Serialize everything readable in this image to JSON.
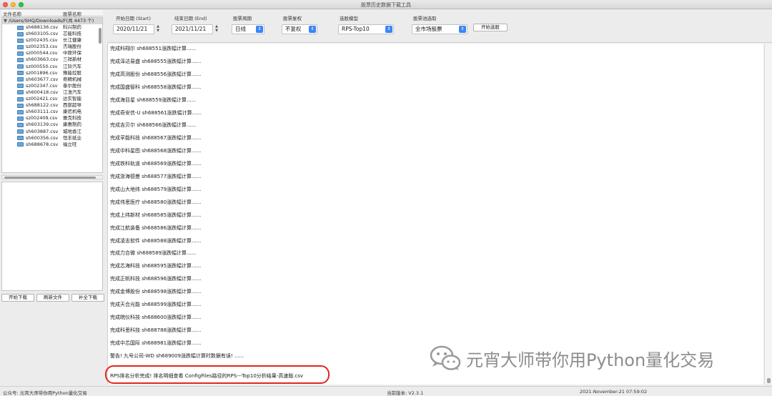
{
  "window": {
    "title": "股票历史数据下载工具"
  },
  "tree": {
    "col_file": "文件名称",
    "col_stock": "股票名称",
    "root": "/Users/SHQ/Downloads/F",
    "root_count": "(共 4473 个)",
    "rows": [
      {
        "file": "sh688136.csv",
        "name": "科兴制药"
      },
      {
        "file": "sh603105.csv",
        "name": "芯能科技"
      },
      {
        "file": "sz002435.csv",
        "name": "长江健康"
      },
      {
        "file": "sz002353.csv",
        "name": "杰瑞股份"
      },
      {
        "file": "sz000544.csv",
        "name": "中原环保"
      },
      {
        "file": "sh603663.csv",
        "name": "三祥新材"
      },
      {
        "file": "sz000550.csv",
        "name": "江铃汽车"
      },
      {
        "file": "sz001896.csv",
        "name": "豫能控股"
      },
      {
        "file": "sh603677.csv",
        "name": "奇精机械"
      },
      {
        "file": "sz002347.csv",
        "name": "泰尔股份"
      },
      {
        "file": "sh600418.csv",
        "name": "江淮汽车"
      },
      {
        "file": "sz002421.csv",
        "name": "达实智能"
      },
      {
        "file": "sh688122.csv",
        "name": "西部超导"
      },
      {
        "file": "sh603111.csv",
        "name": "康尼机电"
      },
      {
        "file": "sz002409.csv",
        "name": "雅克科技"
      },
      {
        "file": "sh603139.csv",
        "name": "康惠制药"
      },
      {
        "file": "sh603887.csv",
        "name": "城地香江"
      },
      {
        "file": "sh600356.csv",
        "name": "恒丰纸业"
      },
      {
        "file": "sh688678.csv",
        "name": "福立旺"
      }
    ]
  },
  "panel_buttons": {
    "download": "开始下载",
    "refresh": "刷新文件",
    "complete": "补全下载"
  },
  "toolbar": {
    "start_label": "开始日期 (Start)",
    "start_value": "2020/11/21",
    "end_label": "结束日期 (End)",
    "end_value": "2021/11/21",
    "period_label": "股票周期",
    "period_value": "日线",
    "adjust_label": "股票复权",
    "adjust_value": "不复权",
    "model_label": "选股模型",
    "model_value": "RPS-Top10",
    "pool_label": "股票池选取",
    "pool_value": "全市场股票",
    "run_button": "开始选股"
  },
  "log": {
    "lines": [
      "完成科翔尔 sh688551涨跌幅计算......",
      "完成泽达易盛 sh688555涨跌幅计算......",
      "完成高测股份 sh688556涨跌幅计算......",
      "完成国盛智科 sh688558涨跌幅计算......",
      "完成海目星 sh688559涨跌幅计算......",
      "完成奇安信-U sh688561涨跌幅计算......",
      "完成吉贝尔 sh688566涨跌幅计算......",
      "完成孚能科技 sh688567涨跌幅计算......",
      "完成中科星图 sh688568涨跌幅计算......",
      "完成铁科轨道 sh688569涨跌幅计算......",
      "完成浙海德曼 sh688577涨跌幅计算......",
      "完成山大地纬 sh688579涨跌幅计算......",
      "完成伟思医疗 sh688580涨跌幅计算......",
      "完成上纬新材 sh688585涨跌幅计算......",
      "完成江航装备 sh688586涨跌幅计算......",
      "完成凌志软件 sh688588涨跌幅计算......",
      "完成力合微 sh688589涨跌幅计算......",
      "完成芯海科技 sh688595涨跌幅计算......",
      "完成正帆科技 sh688596涨跌幅计算......",
      "完成金博股份 sh688598涨跌幅计算......",
      "完成天合光能 sh688599涨跌幅计算......",
      "完成皖仪科技 sh688600涨跌幅计算......",
      "完成科思科技 sh688788涨跌幅计算......",
      "完成中芯国际 sh688981涨跌幅计算......",
      "警告! 九号公司-WD sh689009涨跌幅计算时数据有误! ......"
    ],
    "result": "RPS排名分析完成! 排名明细查看 ConfigFiles路径的RPS---Top10分析结果-高速版.csv"
  },
  "watermark": {
    "text": "元宵大师带你用Python量化交易"
  },
  "status": {
    "left": "公众号: 元宵大师带你用Python量化交易",
    "version": "当前版本: V2.3.1",
    "datetime": "2021-November-21 07:59:02"
  }
}
